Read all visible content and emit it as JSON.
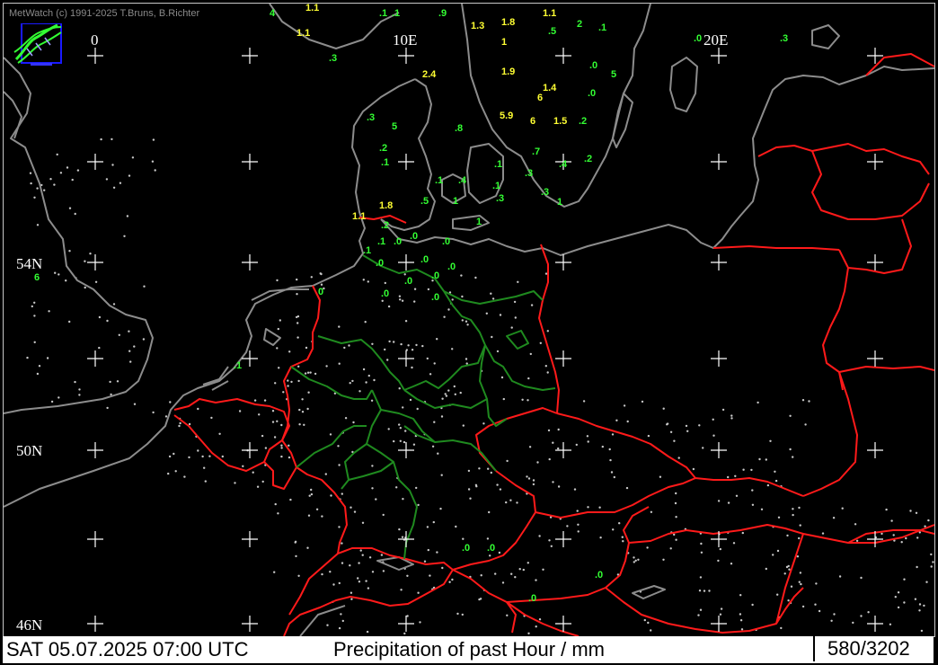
{
  "header": {
    "copyright": "MetWatch  (c) 1991-2025 T.Bruns, B.Richter"
  },
  "axis_labels": {
    "lon_0": "0",
    "lon_10e": "10E",
    "lon_20e": "20E",
    "lat_54n": "54N",
    "lat_50n": "50N",
    "lat_46n": "46N"
  },
  "status_bar": {
    "datetime": "SAT 05.07.2025 07:00 UTC",
    "product": "Precipitation of past  Hour  / mm",
    "counter": "580/3202"
  },
  "colors": {
    "background": "#000000",
    "coastline": "#8c8c8c",
    "country_border": "#ff1a1a",
    "state_border": "#1f8a1f",
    "grid_cross": "#ffffff",
    "value_low": "#33ff33",
    "value_high": "#ffff33"
  },
  "icons": [
    "metwatch-logo-icon",
    "grid-cross-icon",
    "station-dot-icon"
  ],
  "observations": [
    {
      "text": "4"
    },
    {
      "text": "1.1"
    },
    {
      "text": ".1"
    },
    {
      "text": ".1"
    },
    {
      "text": ".9"
    },
    {
      "text": "1.3"
    },
    {
      "text": "1.8"
    },
    {
      "text": "1.1"
    },
    {
      "text": "2"
    },
    {
      "text": ".1"
    },
    {
      "text": "1.1"
    },
    {
      "text": ".3"
    },
    {
      "text": "1"
    },
    {
      "text": ".5"
    },
    {
      "text": ".0"
    },
    {
      "text": ".3"
    },
    {
      "text": ".0"
    },
    {
      "text": "2.4"
    },
    {
      "text": "1.9"
    },
    {
      "text": "5"
    },
    {
      "text": "1.4"
    },
    {
      "text": "6"
    },
    {
      "text": ".0"
    },
    {
      "text": ".2"
    },
    {
      "text": "5"
    },
    {
      "text": ".8"
    },
    {
      "text": "5.9"
    },
    {
      "text": "6"
    },
    {
      "text": "1.5"
    },
    {
      "text": ".2"
    },
    {
      "text": ".3"
    },
    {
      "text": ".1"
    },
    {
      "text": ".7"
    },
    {
      "text": ".1"
    },
    {
      "text": ".3"
    },
    {
      "text": ".4"
    },
    {
      "text": ".2"
    },
    {
      "text": ".1"
    },
    {
      "text": ".4"
    },
    {
      "text": ".3"
    },
    {
      "text": ".1"
    },
    {
      "text": ".5"
    },
    {
      "text": "1"
    },
    {
      "text": "1"
    },
    {
      "text": ".3"
    },
    {
      "text": "1.8"
    },
    {
      "text": "1"
    },
    {
      "text": "1.1"
    },
    {
      "text": ".2"
    },
    {
      "text": ".1"
    },
    {
      "text": ".1"
    },
    {
      "text": ".0"
    },
    {
      "text": ".0"
    },
    {
      "text": ".0"
    },
    {
      "text": ".0"
    },
    {
      "text": ".0"
    },
    {
      "text": ".0"
    },
    {
      "text": ".0"
    },
    {
      "text": ".0"
    },
    {
      "text": "0"
    },
    {
      "text": ".0"
    },
    {
      "text": ".0"
    },
    {
      "text": "6"
    },
    {
      "text": ".1"
    },
    {
      "text": ".0"
    },
    {
      "text": ".0"
    },
    {
      "text": ".0"
    },
    {
      "text": ".0"
    }
  ]
}
